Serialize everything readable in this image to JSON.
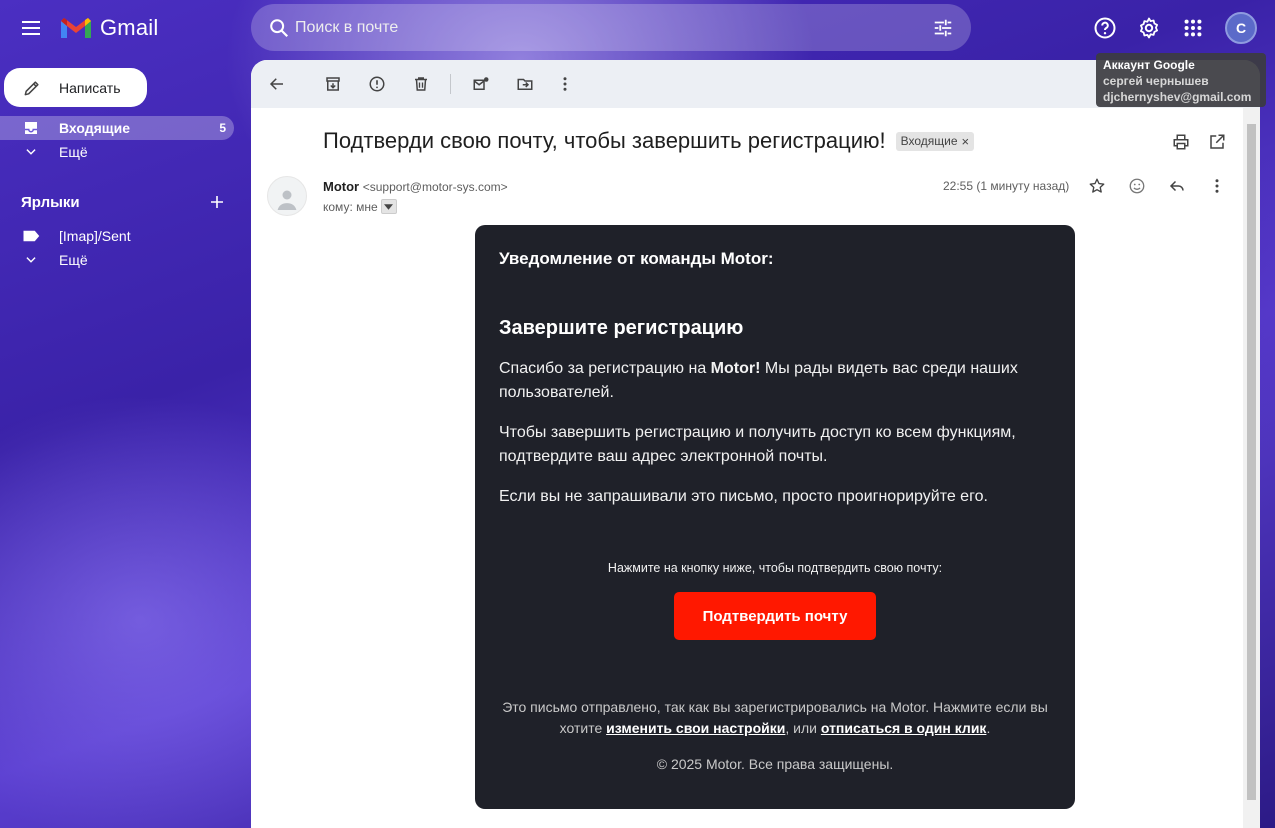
{
  "app": {
    "name": "Gmail"
  },
  "search": {
    "placeholder": "Поиск в почте"
  },
  "header": {
    "avatar_letter": "С"
  },
  "account_tooltip": {
    "title": "Аккаунт Google",
    "name": "сергей чернышев",
    "email": "djchernyshev@gmail.com"
  },
  "sidebar": {
    "compose_label": "Написать",
    "inbox_label": "Входящие",
    "inbox_count": "5",
    "more_label": "Ещё",
    "labels_heading": "Ярлыки",
    "label_items": [
      "[Imap]/Sent"
    ],
    "more_label_2": "Ещё"
  },
  "message": {
    "subject": "Подтверди свою почту, чтобы завершить регистрацию!",
    "chip": "Входящие",
    "chip_close": "×",
    "sender_name": "Motor",
    "sender_email": "<support@motor-sys.com>",
    "to_line": "кому: мне",
    "time": "22:55 (1 минуту назад)"
  },
  "email_body": {
    "notice": "Уведомление от команды Motor:",
    "title": "Завершите регистрацию",
    "p1_before": "Спасибо за регистрацию на ",
    "p1_bold": "Motor!",
    "p1_after": " Мы рады видеть вас среди наших пользователей.",
    "p2": "Чтобы завершить регистрацию и получить доступ ко всем функциям, подтвердите ваш адрес электронной почты.",
    "p3": "Если вы не запрашивали это письмо, просто проигнорируйте его.",
    "hint": "Нажмите на кнопку ниже, чтобы подтвердить свою почту:",
    "button": "Подтвердить почту",
    "footer_before": "Это письмо отправлено, так как вы зарегистрировались на Motor. Нажмите если вы хотите ",
    "footer_link1": "изменить свои настройки",
    "footer_mid": ", или ",
    "footer_link2": "отписаться в один клик",
    "footer_after": ".",
    "copyright": "© 2025 Motor. Все права защищены."
  },
  "colors": {
    "button_red": "#ff1800",
    "card_bg": "#1f2129"
  }
}
